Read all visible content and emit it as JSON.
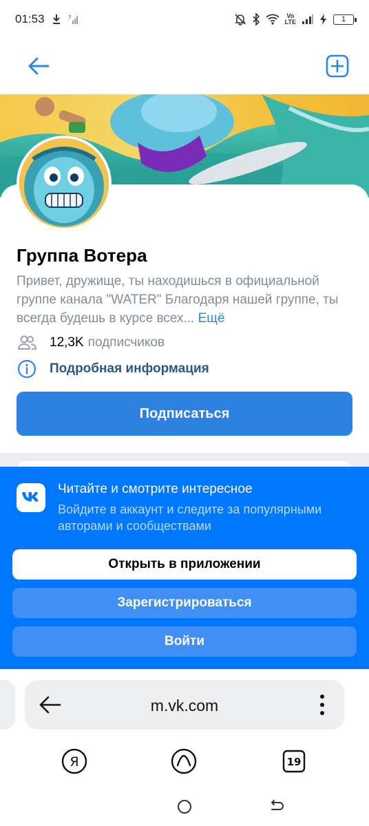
{
  "status_bar": {
    "time": "01:53",
    "lte_top": "Vo",
    "lte_bottom": "LTE",
    "battery": "1"
  },
  "nav": {
    "back_icon": "arrow-left-icon",
    "add_icon": "plus-square-icon"
  },
  "group": {
    "name": "Группа Вотера",
    "description": "Привет, дружище, ты находишься в официальной группе канала \"WATER\" Благодаря нашей группе, ты всегда будешь в курсе всех...",
    "more_link": "Ещё",
    "subscribers_count": "12,3K",
    "subscribers_label": "подписчиков",
    "details_link": "Подробная информация",
    "subscribe_button": "Подписаться"
  },
  "promo": {
    "title": "Читайте и смотрите интересное",
    "subtitle": "Войдите в аккаунт и следите за популярными авторами и сообществами",
    "open_app_button": "Открыть в приложении",
    "register_button": "Зарегистрироваться",
    "login_button": "Войти"
  },
  "browser": {
    "url": "m.vk.com",
    "tabs_count": "19"
  },
  "colors": {
    "accent": "#2d81e0",
    "promo_bg": "#0077ff",
    "link": "#2688eb",
    "secondary_text": "#818c99"
  }
}
